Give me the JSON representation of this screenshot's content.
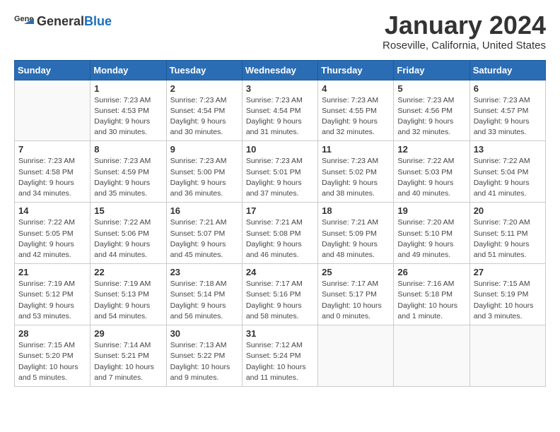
{
  "logo": {
    "general": "General",
    "blue": "Blue"
  },
  "title": "January 2024",
  "subtitle": "Roseville, California, United States",
  "days_header": [
    "Sunday",
    "Monday",
    "Tuesday",
    "Wednesday",
    "Thursday",
    "Friday",
    "Saturday"
  ],
  "weeks": [
    [
      {
        "day": "",
        "info": ""
      },
      {
        "day": "1",
        "info": "Sunrise: 7:23 AM\nSunset: 4:53 PM\nDaylight: 9 hours\nand 30 minutes."
      },
      {
        "day": "2",
        "info": "Sunrise: 7:23 AM\nSunset: 4:54 PM\nDaylight: 9 hours\nand 30 minutes."
      },
      {
        "day": "3",
        "info": "Sunrise: 7:23 AM\nSunset: 4:54 PM\nDaylight: 9 hours\nand 31 minutes."
      },
      {
        "day": "4",
        "info": "Sunrise: 7:23 AM\nSunset: 4:55 PM\nDaylight: 9 hours\nand 32 minutes."
      },
      {
        "day": "5",
        "info": "Sunrise: 7:23 AM\nSunset: 4:56 PM\nDaylight: 9 hours\nand 32 minutes."
      },
      {
        "day": "6",
        "info": "Sunrise: 7:23 AM\nSunset: 4:57 PM\nDaylight: 9 hours\nand 33 minutes."
      }
    ],
    [
      {
        "day": "7",
        "info": "Sunrise: 7:23 AM\nSunset: 4:58 PM\nDaylight: 9 hours\nand 34 minutes."
      },
      {
        "day": "8",
        "info": "Sunrise: 7:23 AM\nSunset: 4:59 PM\nDaylight: 9 hours\nand 35 minutes."
      },
      {
        "day": "9",
        "info": "Sunrise: 7:23 AM\nSunset: 5:00 PM\nDaylight: 9 hours\nand 36 minutes."
      },
      {
        "day": "10",
        "info": "Sunrise: 7:23 AM\nSunset: 5:01 PM\nDaylight: 9 hours\nand 37 minutes."
      },
      {
        "day": "11",
        "info": "Sunrise: 7:23 AM\nSunset: 5:02 PM\nDaylight: 9 hours\nand 38 minutes."
      },
      {
        "day": "12",
        "info": "Sunrise: 7:22 AM\nSunset: 5:03 PM\nDaylight: 9 hours\nand 40 minutes."
      },
      {
        "day": "13",
        "info": "Sunrise: 7:22 AM\nSunset: 5:04 PM\nDaylight: 9 hours\nand 41 minutes."
      }
    ],
    [
      {
        "day": "14",
        "info": "Sunrise: 7:22 AM\nSunset: 5:05 PM\nDaylight: 9 hours\nand 42 minutes."
      },
      {
        "day": "15",
        "info": "Sunrise: 7:22 AM\nSunset: 5:06 PM\nDaylight: 9 hours\nand 44 minutes."
      },
      {
        "day": "16",
        "info": "Sunrise: 7:21 AM\nSunset: 5:07 PM\nDaylight: 9 hours\nand 45 minutes."
      },
      {
        "day": "17",
        "info": "Sunrise: 7:21 AM\nSunset: 5:08 PM\nDaylight: 9 hours\nand 46 minutes."
      },
      {
        "day": "18",
        "info": "Sunrise: 7:21 AM\nSunset: 5:09 PM\nDaylight: 9 hours\nand 48 minutes."
      },
      {
        "day": "19",
        "info": "Sunrise: 7:20 AM\nSunset: 5:10 PM\nDaylight: 9 hours\nand 49 minutes."
      },
      {
        "day": "20",
        "info": "Sunrise: 7:20 AM\nSunset: 5:11 PM\nDaylight: 9 hours\nand 51 minutes."
      }
    ],
    [
      {
        "day": "21",
        "info": "Sunrise: 7:19 AM\nSunset: 5:12 PM\nDaylight: 9 hours\nand 53 minutes."
      },
      {
        "day": "22",
        "info": "Sunrise: 7:19 AM\nSunset: 5:13 PM\nDaylight: 9 hours\nand 54 minutes."
      },
      {
        "day": "23",
        "info": "Sunrise: 7:18 AM\nSunset: 5:14 PM\nDaylight: 9 hours\nand 56 minutes."
      },
      {
        "day": "24",
        "info": "Sunrise: 7:17 AM\nSunset: 5:16 PM\nDaylight: 9 hours\nand 58 minutes."
      },
      {
        "day": "25",
        "info": "Sunrise: 7:17 AM\nSunset: 5:17 PM\nDaylight: 10 hours\nand 0 minutes."
      },
      {
        "day": "26",
        "info": "Sunrise: 7:16 AM\nSunset: 5:18 PM\nDaylight: 10 hours\nand 1 minute."
      },
      {
        "day": "27",
        "info": "Sunrise: 7:15 AM\nSunset: 5:19 PM\nDaylight: 10 hours\nand 3 minutes."
      }
    ],
    [
      {
        "day": "28",
        "info": "Sunrise: 7:15 AM\nSunset: 5:20 PM\nDaylight: 10 hours\nand 5 minutes."
      },
      {
        "day": "29",
        "info": "Sunrise: 7:14 AM\nSunset: 5:21 PM\nDaylight: 10 hours\nand 7 minutes."
      },
      {
        "day": "30",
        "info": "Sunrise: 7:13 AM\nSunset: 5:22 PM\nDaylight: 10 hours\nand 9 minutes."
      },
      {
        "day": "31",
        "info": "Sunrise: 7:12 AM\nSunset: 5:24 PM\nDaylight: 10 hours\nand 11 minutes."
      },
      {
        "day": "",
        "info": ""
      },
      {
        "day": "",
        "info": ""
      },
      {
        "day": "",
        "info": ""
      }
    ]
  ]
}
